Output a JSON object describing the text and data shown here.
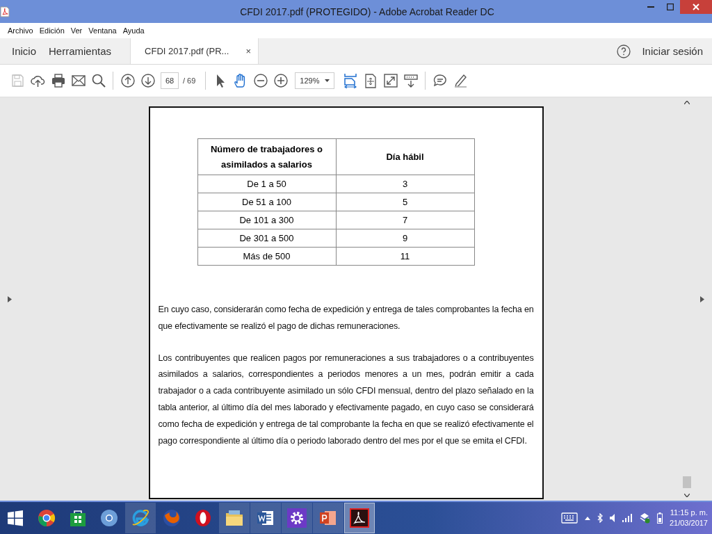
{
  "window": {
    "title": "CFDI 2017.pdf (PROTEGIDO) - Adobe Acrobat Reader DC"
  },
  "menu": [
    "Archivo",
    "Edición",
    "Ver",
    "Ventana",
    "Ayuda"
  ],
  "tabs": [
    {
      "label": "Inicio",
      "kind": "nav",
      "selected": false
    },
    {
      "label": "Herramientas",
      "kind": "nav",
      "selected": false
    },
    {
      "label": "CFDI 2017.pdf (PR...",
      "kind": "document",
      "selected": true,
      "close": "×"
    }
  ],
  "signin": "Iniciar sesión",
  "toolbar": [
    {
      "kind": "save",
      "disabled": true
    },
    {
      "kind": "upload",
      "disabled": false
    },
    {
      "kind": "print",
      "disabled": false
    },
    {
      "kind": "mail",
      "disabled": false
    },
    {
      "kind": "search",
      "disabled": false
    },
    {
      "kind": "sep"
    },
    {
      "kind": "page-up",
      "disabled": false
    },
    {
      "kind": "page-down",
      "disabled": false
    },
    {
      "kind": "page",
      "value": "68",
      "total": "/ 69"
    },
    {
      "kind": "sep"
    },
    {
      "kind": "pointer",
      "selected": false
    },
    {
      "kind": "hand",
      "selected": true
    },
    {
      "kind": "zoom-out",
      "disabled": false
    },
    {
      "kind": "zoom-in",
      "disabled": false
    },
    {
      "kind": "zoom",
      "value": "129%"
    },
    {
      "kind": "fit-width",
      "selected": true
    },
    {
      "kind": "fit-page",
      "selected": false
    },
    {
      "kind": "fullscreen",
      "selected": false
    },
    {
      "kind": "more-tools",
      "selected": false
    },
    {
      "kind": "sep"
    },
    {
      "kind": "comment",
      "disabled": false
    },
    {
      "kind": "pen",
      "disabled": false
    }
  ],
  "document": {
    "table": {
      "columns": [
        "Número de trabajadores o asimilados a salarios",
        "Día hábil"
      ],
      "rows": [
        [
          "De 1 a 50",
          "3"
        ],
        [
          "De 51 a 100",
          "5"
        ],
        [
          "De 101 a 300",
          "7"
        ],
        [
          "De 301 a 500",
          "9"
        ],
        [
          "Más de 500",
          "11"
        ]
      ]
    },
    "paragraphs": [
      "En cuyo caso, considerarán como fecha de expedición y entrega de tales comprobantes la fecha en que efectivamente se realizó el pago de dichas remuneraciones.",
      "Los contribuyentes que realicen pagos por remuneraciones a sus trabajadores o a contribuyentes asimilados a salarios, correspondientes a periodos menores a un mes, podrán emitir a cada trabajador o a cada contribuyente asimilado un sólo CFDI mensual, dentro del plazo señalado en la tabla anterior, al último día del mes laborado y efectivamente pagado, en cuyo caso se considerará como fecha de expedición y entrega de tal comprobante la fecha en que se realizó efectivamente el pago correspondiente al último día o periodo laborado dentro del mes por el que se emita el CFDI."
    ]
  },
  "taskbar": {
    "apps": [
      {
        "kind": "start",
        "open": false,
        "selected": false
      },
      {
        "kind": "chrome",
        "open": false,
        "selected": false
      },
      {
        "kind": "store",
        "open": false,
        "selected": false
      },
      {
        "kind": "chromium",
        "open": false,
        "selected": false
      },
      {
        "kind": "ie",
        "open": true,
        "selected": false
      },
      {
        "kind": "firefox",
        "open": false,
        "selected": false
      },
      {
        "kind": "opera",
        "open": false,
        "selected": false
      },
      {
        "kind": "explorer",
        "open": true,
        "selected": false
      },
      {
        "kind": "word",
        "open": true,
        "selected": false
      },
      {
        "kind": "settings",
        "open": true,
        "selected": false
      },
      {
        "kind": "powerpoint",
        "open": true,
        "selected": false
      },
      {
        "kind": "acrobat",
        "open": true,
        "selected": true
      }
    ],
    "time": "11:15 p. m.",
    "date": "21/03/2017"
  }
}
